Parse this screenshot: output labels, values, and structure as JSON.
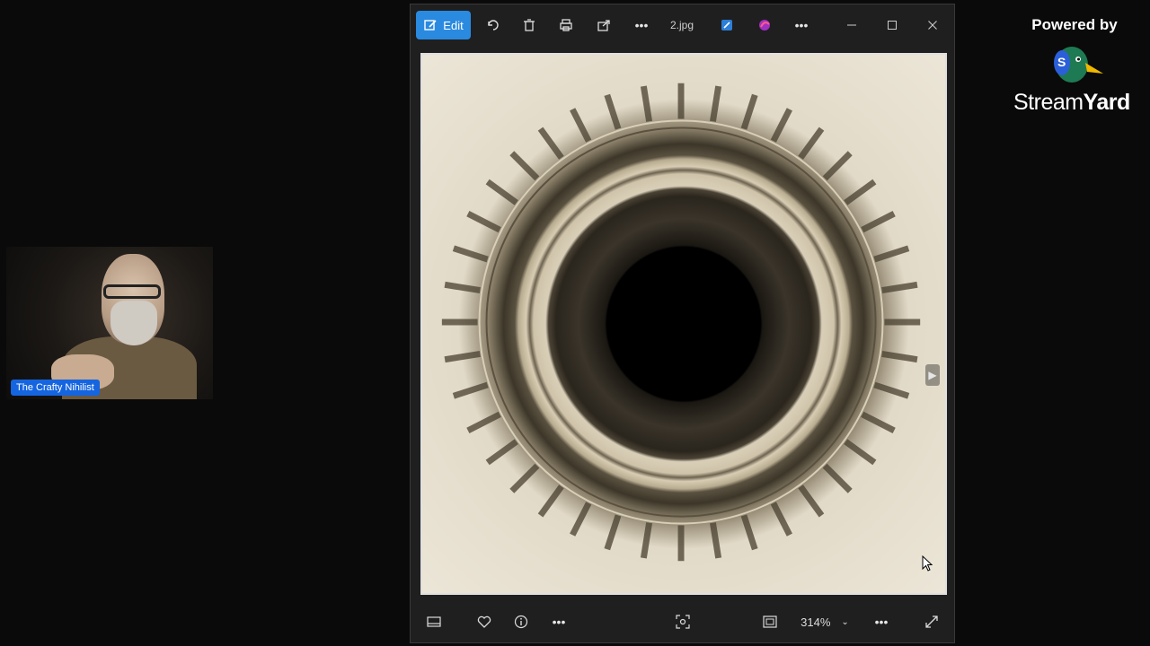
{
  "viewer": {
    "toolbar": {
      "edit_label": "Edit",
      "filename": "2.jpg",
      "icons": [
        "edit-icon",
        "rotate-icon",
        "delete-icon",
        "print-icon",
        "share-icon",
        "more-icon",
        "paint-icon",
        "designer-icon",
        "more-icon",
        "minimize-icon",
        "maximize-icon",
        "close-icon"
      ]
    },
    "bottombar": {
      "zoom": "314%",
      "icons": [
        "filmstrip-icon",
        "favorite-icon",
        "info-icon",
        "more-icon",
        "fit-icon",
        "view-icon",
        "more-icon",
        "fullscreen-icon"
      ]
    }
  },
  "webcam": {
    "name": "The Crafty Nihilist"
  },
  "branding": {
    "powered_by": "Powered by",
    "logo_text_a": "Stream",
    "logo_text_b": "Yard",
    "accent": "#1565e0"
  }
}
